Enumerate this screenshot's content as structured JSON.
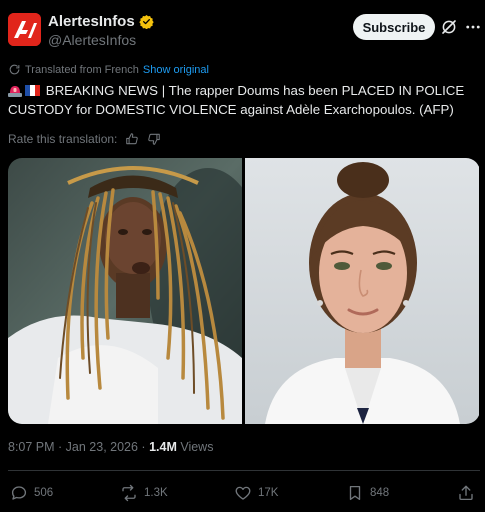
{
  "account": {
    "name": "AlertesInfos",
    "handle": "@AlertesInfos",
    "verified_color": "#f4c20d",
    "brand_color": "#e1251b"
  },
  "header": {
    "subscribe_label": "Subscribe"
  },
  "translation": {
    "notice": "Translated from French",
    "show_original": "Show original"
  },
  "tweet": {
    "text": "BREAKING NEWS | The rapper Doums has been PLACED IN POLICE CUSTODY for DOMESTIC VIOLENCE against Adèle Exarchopoulos. (AFP)"
  },
  "rate": {
    "label": "Rate this translation:"
  },
  "meta": {
    "time": "8:07 PM · Jan 23, 2026 · ",
    "views_count": "1.4M",
    "views_label": " Views"
  },
  "actions": {
    "replies": "506",
    "reposts": "1.3K",
    "likes": "17K",
    "bookmarks": "848"
  },
  "colors": {
    "background": "#000000",
    "text": "#e7e9ea",
    "muted": "#71767b",
    "link": "#1d9bf0"
  }
}
